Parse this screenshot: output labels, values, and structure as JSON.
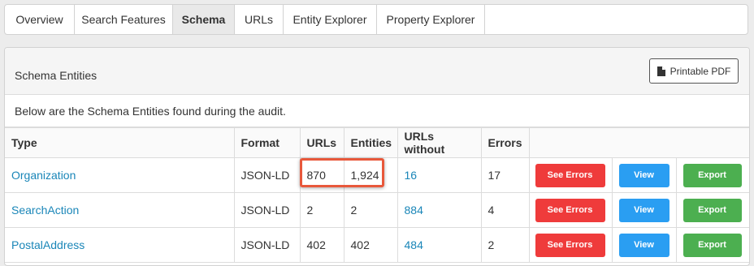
{
  "tabs": [
    {
      "label": "Overview",
      "active": false
    },
    {
      "label": "Search Features",
      "active": false
    },
    {
      "label": "Schema",
      "active": true
    },
    {
      "label": "URLs",
      "active": false
    },
    {
      "label": "Entity Explorer",
      "active": false
    },
    {
      "label": "Property Explorer",
      "active": false
    }
  ],
  "panel": {
    "title": "Schema Entities",
    "pdf_button": "Printable PDF",
    "description": "Below are the Schema Entities found during the audit."
  },
  "table": {
    "headers": [
      "Type",
      "Format",
      "URLs",
      "Entities",
      "URLs without",
      "Errors",
      ""
    ],
    "rows": [
      {
        "type": "Organization",
        "format": "JSON-LD",
        "urls": "870",
        "entities": "1,924",
        "urls_without": "16",
        "errors": "17"
      },
      {
        "type": "SearchAction",
        "format": "JSON-LD",
        "urls": "2",
        "entities": "2",
        "urls_without": "884",
        "errors": "4"
      },
      {
        "type": "PostalAddress",
        "format": "JSON-LD",
        "urls": "402",
        "entities": "402",
        "urls_without": "484",
        "errors": "2"
      }
    ],
    "actions": {
      "see_errors": "See Errors",
      "view": "View",
      "export": "Export"
    }
  },
  "colors": {
    "link": "#1a86b8",
    "see_errors": "#ef3b3b",
    "view": "#2a9ef2",
    "export": "#4caf50",
    "highlight_box": "#e8583b"
  },
  "icons": {
    "pdf": "document-icon"
  }
}
